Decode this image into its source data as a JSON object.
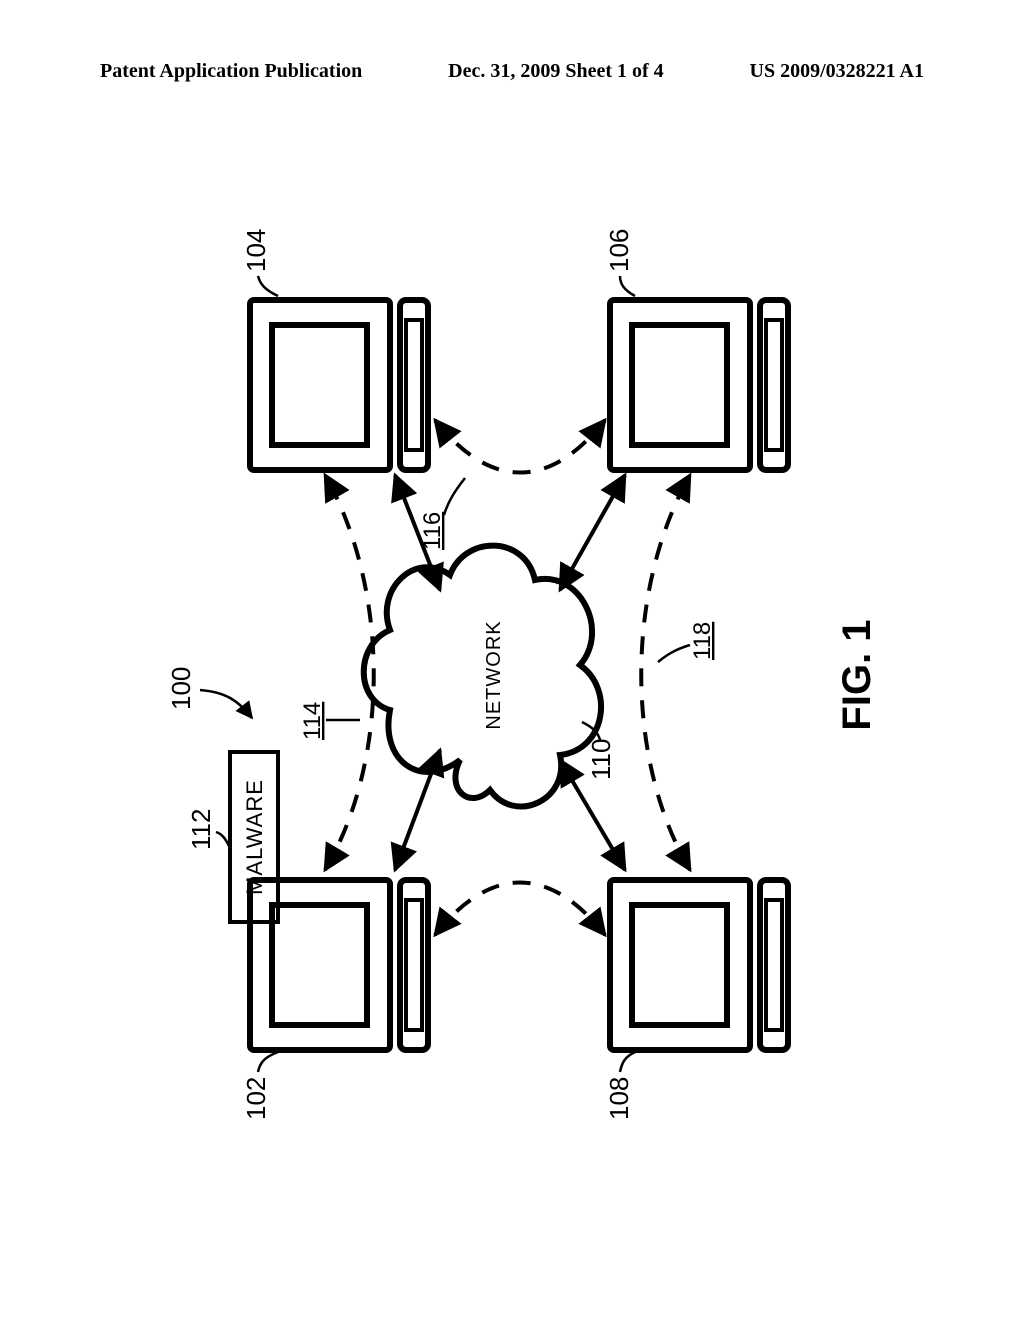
{
  "header": {
    "left": "Patent Application Publication",
    "center": "Dec. 31, 2009  Sheet 1 of 4",
    "right": "US 2009/0328221 A1"
  },
  "figure": {
    "label": "FIG. 1",
    "system_ref": "100",
    "network_label": "NETWORK",
    "network_ref": "110",
    "malware_label": "MALWARE",
    "malware_ref": "112",
    "computers": {
      "top_left": "102",
      "top_right": "104",
      "bottom_right": "106",
      "bottom_left": "108"
    },
    "dashed_links": {
      "top": "114",
      "right": "116",
      "bottom": "118"
    }
  }
}
